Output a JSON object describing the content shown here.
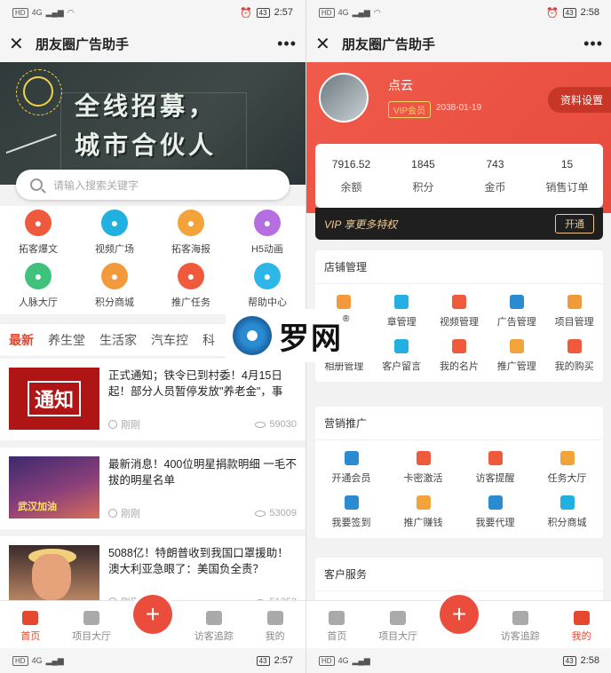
{
  "status_left": {
    "time": "2:57",
    "battery": "43",
    "network": "4G"
  },
  "status_right": {
    "time": "2:58",
    "battery": "43",
    "network": "4G"
  },
  "app_title": "朋友圈广告助手",
  "left": {
    "banner": {
      "line1": "全线招募，",
      "line2": "城市合伙人"
    },
    "search_placeholder": "请输入搜索关键字",
    "grid": [
      {
        "label": "拓客爆文",
        "icon": "fire-icon",
        "color": "#f05a3c"
      },
      {
        "label": "视频广场",
        "icon": "video-icon",
        "color": "#22b0e0"
      },
      {
        "label": "拓客海报",
        "icon": "image-icon",
        "color": "#f2a43b"
      },
      {
        "label": "H5动画",
        "icon": "lightning-icon",
        "color": "#b56fe0"
      },
      {
        "label": "人脉大厅",
        "icon": "people-icon",
        "color": "#3fc27b"
      },
      {
        "label": "积分商城",
        "icon": "shop-icon",
        "color": "#f29a3b"
      },
      {
        "label": "推广任务",
        "icon": "task-icon",
        "color": "#f05a3c"
      },
      {
        "label": "帮助中心",
        "icon": "bulb-icon",
        "color": "#2eb6e8"
      }
    ],
    "tabs": [
      "最新",
      "养生堂",
      "生活家",
      "汽车控",
      "科"
    ],
    "news": [
      {
        "title": "正式通知；铁令已到村委！4月15日起！部分人员暂停发放\"养老金\"，事关...",
        "time": "刚刚",
        "views": "59030",
        "thumb_text": "通知"
      },
      {
        "title": "最新消息！400位明星捐款明细 一毛不拔的明星名单",
        "time": "刚刚",
        "views": "53009",
        "thumb_text": "武汉加油"
      },
      {
        "title": "5088亿！特朗普收到我国口罩援助！澳大利亚急眼了：美国负全责？",
        "time": "刚刚",
        "views": "51352",
        "thumb_text": ""
      }
    ],
    "tabbar": [
      "首页",
      "项目大厅",
      "访客追踪",
      "我的"
    ]
  },
  "right": {
    "user_name": "点云",
    "vip_label": "VIP会员",
    "vip_date": "2038-01-19",
    "settings_label": "资料设置",
    "stats": [
      {
        "value": "7916.52",
        "label": "余额"
      },
      {
        "value": "1845",
        "label": "积分"
      },
      {
        "value": "743",
        "label": "金币"
      },
      {
        "value": "15",
        "label": "销售订单"
      }
    ],
    "vip_strip": "VIP 享更多特权",
    "open_label": "开通",
    "store_title": "店铺管理",
    "store_items": [
      {
        "label": "章管理",
        "color": "#f29a3b"
      },
      {
        "label": "章管理",
        "color": "#22b0e0"
      },
      {
        "label": "视频管理",
        "color": "#f05a3c"
      },
      {
        "label": "广告管理",
        "color": "#2a8bd1"
      },
      {
        "label": "项目管理",
        "color": "#f29a3b"
      },
      {
        "label": "相册管理",
        "color": "#f05a3c"
      },
      {
        "label": "客户留言",
        "color": "#22b0e0"
      },
      {
        "label": "我的名片",
        "color": "#f05a3c"
      },
      {
        "label": "推广管理",
        "color": "#f2a43b"
      },
      {
        "label": "我的购买",
        "color": "#f05a3c"
      }
    ],
    "marketing_title": "营销推广",
    "marketing_items": [
      {
        "label": "开通会员",
        "color": "#2a8bd1"
      },
      {
        "label": "卡密激活",
        "color": "#f05a3c"
      },
      {
        "label": "访客提醒",
        "color": "#f05a3c"
      },
      {
        "label": "任务大厅",
        "color": "#f2a43b"
      },
      {
        "label": "我要签到",
        "color": "#2a8bd1"
      },
      {
        "label": "推广赚钱",
        "color": "#f2a43b"
      },
      {
        "label": "我要代理",
        "color": "#2a8bd1"
      },
      {
        "label": "积分商城",
        "color": "#22b0e0"
      }
    ],
    "service_title": "客户服务",
    "tabbar": [
      "首页",
      "项目大厅",
      "访客追踪",
      "我的"
    ]
  },
  "watermark": {
    "text": "罗网",
    "mark": "®"
  }
}
